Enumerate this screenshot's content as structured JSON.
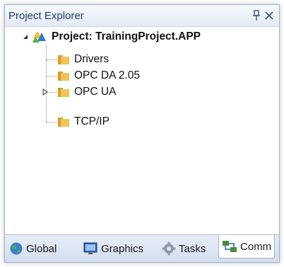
{
  "panel": {
    "title": "Project Explorer"
  },
  "tree": {
    "root": {
      "label": "Project: TrainingProject.APP",
      "expanded": true
    },
    "children": [
      {
        "label": "Drivers"
      },
      {
        "label": "OPC DA 2.05"
      },
      {
        "label": "OPC UA",
        "has_children": true,
        "expanded": false
      },
      {
        "label": "TCP/IP"
      }
    ]
  },
  "tabs": [
    {
      "label": "Global",
      "icon": "globe-icon"
    },
    {
      "label": "Graphics",
      "icon": "graphics-icon"
    },
    {
      "label": "Tasks",
      "icon": "gear-icon"
    },
    {
      "label": "Comm",
      "icon": "comm-icon",
      "active": true
    }
  ],
  "colors": {
    "folder": "#e8b84a",
    "header_text": "#1f3a66",
    "accent": "#2b5fb3"
  }
}
